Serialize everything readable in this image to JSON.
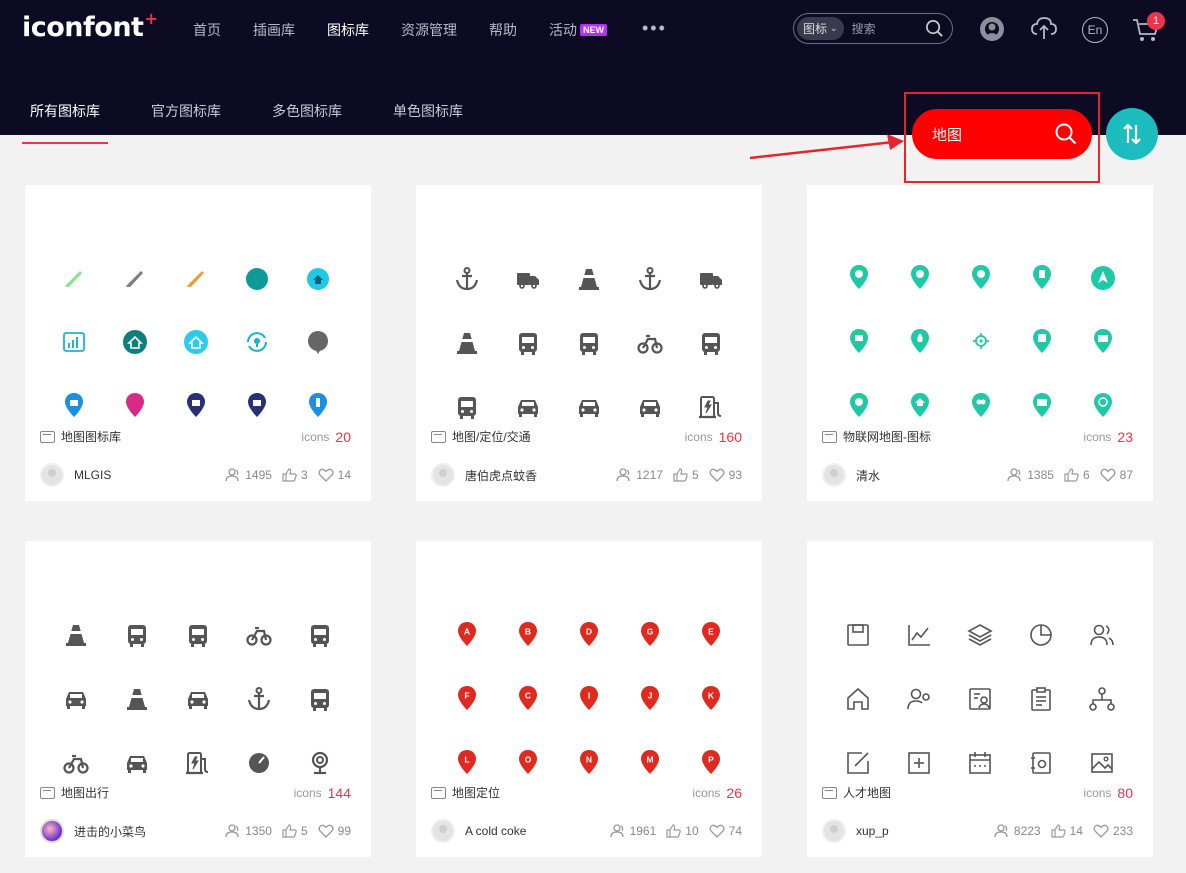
{
  "header": {
    "logo_text": "iconfont",
    "logo_plus": "+",
    "nav": [
      {
        "label": "首页",
        "active": false
      },
      {
        "label": "插画库",
        "active": false
      },
      {
        "label": "图标库",
        "active": true
      },
      {
        "label": "资源管理",
        "active": false
      },
      {
        "label": "帮助",
        "active": false
      },
      {
        "label": "活动",
        "active": false,
        "badge": "NEW"
      }
    ],
    "more": "•••",
    "search": {
      "type": "图标",
      "placeholder": "搜索"
    },
    "lang": "En",
    "cart_count": "1"
  },
  "subnav": [
    {
      "label": "所有图标库",
      "active": true
    },
    {
      "label": "官方图标库",
      "active": false
    },
    {
      "label": "多色图标库",
      "active": false
    },
    {
      "label": "单色图标库",
      "active": false
    }
  ],
  "library_search": {
    "value": "地图"
  },
  "colors": {
    "accent": "#f0334a",
    "teal": "#1cbcbf",
    "header_bg": "#0d0b23",
    "pill": "#ff0000"
  },
  "cards": [
    {
      "title": "地图图标库",
      "icons_label": "icons",
      "count": "20",
      "author": "MLGIS",
      "views": "1495",
      "likes": "3",
      "favs": "14"
    },
    {
      "title": "地图/定位/交通",
      "icons_label": "icons",
      "count": "160",
      "author": "唐伯虎点蚊香",
      "views": "1217",
      "likes": "5",
      "favs": "93"
    },
    {
      "title": "物联网地图-图标",
      "icons_label": "icons",
      "count": "23",
      "author": "清水",
      "views": "1385",
      "likes": "6",
      "favs": "87"
    },
    {
      "title": "地图出行",
      "icons_label": "icons",
      "count": "144",
      "author": "进击的小菜鸟",
      "views": "1350",
      "likes": "5",
      "favs": "99"
    },
    {
      "title": "地图定位",
      "icons_label": "icons",
      "count": "26",
      "author": "A cold coke",
      "views": "1961",
      "likes": "10",
      "favs": "74"
    },
    {
      "title": "人才地图",
      "icons_label": "icons",
      "count": "80",
      "author": "xup_p",
      "views": "8223",
      "likes": "14",
      "favs": "233"
    }
  ],
  "pin_letters": [
    "A",
    "B",
    "D",
    "G",
    "E",
    "F",
    "C",
    "I",
    "J",
    "K",
    "L",
    "O",
    "N",
    "M",
    "P"
  ]
}
